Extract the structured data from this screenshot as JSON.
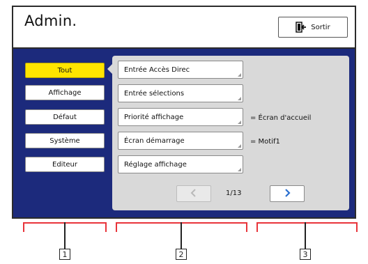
{
  "header": {
    "title": "Admin.",
    "exit_label": "Sortir"
  },
  "categories": [
    {
      "label": "Tout",
      "active": true
    },
    {
      "label": "Affichage",
      "active": false
    },
    {
      "label": "Défaut",
      "active": false
    },
    {
      "label": "Système",
      "active": false
    },
    {
      "label": "Editeur",
      "active": false
    }
  ],
  "items": [
    {
      "label": "Entrée Accès Direc",
      "value": ""
    },
    {
      "label": "Entrée sélections",
      "value": ""
    },
    {
      "label": "Priorité affichage",
      "value": "= Écran d'accueil"
    },
    {
      "label": "Écran démarrage",
      "value": "= Motif1"
    },
    {
      "label": "Réglage affichage",
      "value": ""
    }
  ],
  "pagination": {
    "page": "1/13",
    "prev_icon": "chevron-left-icon",
    "next_icon": "chevron-right-icon"
  },
  "callouts": [
    "1",
    "2",
    "3"
  ],
  "colors": {
    "active_tab": "#ffe500",
    "body_background": "#1c2a7c",
    "panel_background": "#d9d9d9",
    "callout_bracket": "#e8343a"
  }
}
